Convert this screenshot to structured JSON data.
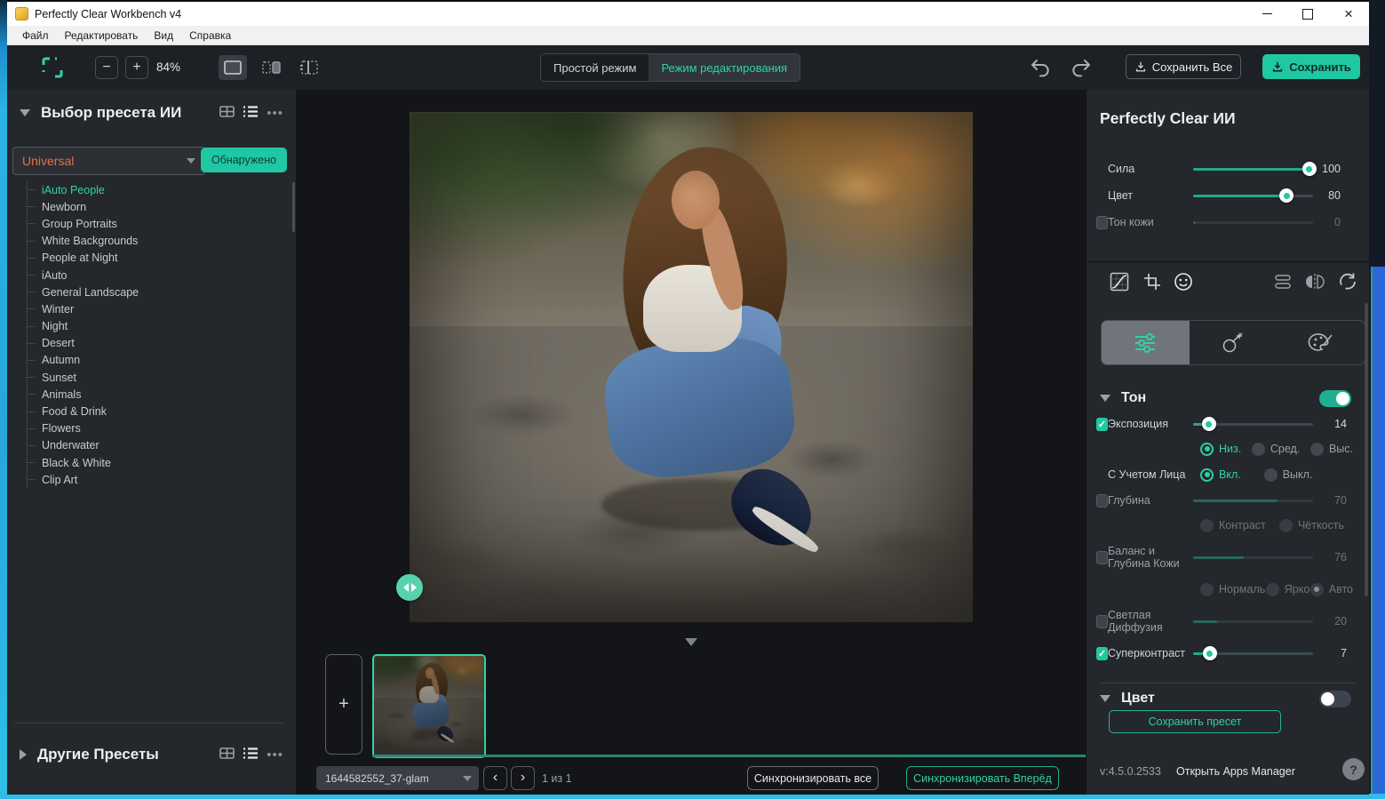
{
  "window": {
    "title": "Perfectly Clear Workbench v4"
  },
  "menu": {
    "items": [
      "Файл",
      "Редактировать",
      "Вид",
      "Справка"
    ]
  },
  "toolbar": {
    "zoom_value": "84%",
    "minus": "−",
    "plus": "+",
    "modes": {
      "simple": "Простой режим",
      "edit": "Режим редактирования"
    },
    "save_all": "Сохранить Все",
    "save": "Сохранить"
  },
  "preset_panel": {
    "title": "Выбор пресета ИИ",
    "dropdown_value": "Universal",
    "detected": "Обнаружено",
    "selected_preset": "iAuto People",
    "presets": [
      "iAuto People",
      "Newborn",
      "Group Portraits",
      "White Backgrounds",
      "People at Night",
      "iAuto",
      "General Landscape",
      "Winter",
      "Night",
      "Desert",
      "Autumn",
      "Sunset",
      "Animals",
      "Food & Drink",
      "Flowers",
      "Underwater",
      "Black & White",
      "Clip Art"
    ],
    "other_presets_title": "Другие Пресеты"
  },
  "filmstrip": {
    "add": "+",
    "filename": "1644582552_37-glam",
    "counter": "1 из 1",
    "sync_all": "Синхронизировать все",
    "sync_forward": "Синхронизировать Вперёд"
  },
  "ai_panel": {
    "title": "Perfectly Clear ИИ",
    "sliders": [
      {
        "label": "Сила",
        "value": "100",
        "pct": 97,
        "checkbox": false,
        "enabled": true
      },
      {
        "label": "Цвет",
        "value": "80",
        "pct": 78,
        "checkbox": false,
        "enabled": true
      },
      {
        "label": "Тон кожи",
        "value": "0",
        "pct": 2,
        "checkbox": true,
        "checked": false,
        "enabled": false
      }
    ],
    "tone_section": {
      "title": "Тон",
      "toggle_on": true,
      "rows": [
        {
          "type": "slider",
          "label": "Экспозиция",
          "value": "14",
          "pct": 13,
          "checkbox": true,
          "checked": true,
          "enabled": true
        },
        {
          "type": "radios",
          "options": [
            {
              "label": "Низ.",
              "selected": true
            },
            {
              "label": "Сред."
            },
            {
              "label": "Выс."
            }
          ],
          "enabled": true,
          "layout": "spread3"
        },
        {
          "type": "radios",
          "label": "С Учетом Лица",
          "options": [
            {
              "label": "Вкл.",
              "selected": true
            },
            {
              "label": "Выкл."
            }
          ],
          "enabled": true,
          "layout": "pair"
        },
        {
          "type": "slider",
          "label": "Глубина",
          "value": "70",
          "pct": 70,
          "checkbox": true,
          "checked": false,
          "enabled": false
        },
        {
          "type": "radios",
          "options": [
            {
              "label": "Контраст"
            },
            {
              "label": "Чёткость"
            }
          ],
          "enabled": false,
          "layout": "spread2"
        },
        {
          "type": "slider",
          "label": "Баланс и Глубина Кожи",
          "value": "76",
          "pct": 42,
          "checkbox": true,
          "checked": false,
          "enabled": false,
          "twoline": true
        },
        {
          "type": "radios",
          "options": [
            {
              "label": "Нормаль"
            },
            {
              "label": "Ярко"
            },
            {
              "label": "Авто",
              "dim_selected": true
            }
          ],
          "enabled": false,
          "layout": "spread3"
        },
        {
          "type": "slider",
          "label": "Светлая Диффузия",
          "value": "20",
          "pct": 20,
          "checkbox": true,
          "checked": false,
          "enabled": false,
          "twoline": true
        },
        {
          "type": "slider",
          "label": "Суперконтраст",
          "value": "7",
          "pct": 14,
          "checkbox": true,
          "checked": true,
          "enabled": true
        }
      ]
    },
    "color_section": {
      "title": "Цвет",
      "toggle_on": false
    },
    "save_preset": "Сохранить пресет",
    "version": "v:4.5.0.2533",
    "apps_manager": "Открыть Apps Manager",
    "help": "?"
  },
  "colors": {
    "accent_green": "#1fc8a2",
    "accent_text_green": "#2ed3a7",
    "universal_orange": "#e0714b",
    "panel_bg": "#24272b",
    "canvas_bg": "#131518"
  }
}
